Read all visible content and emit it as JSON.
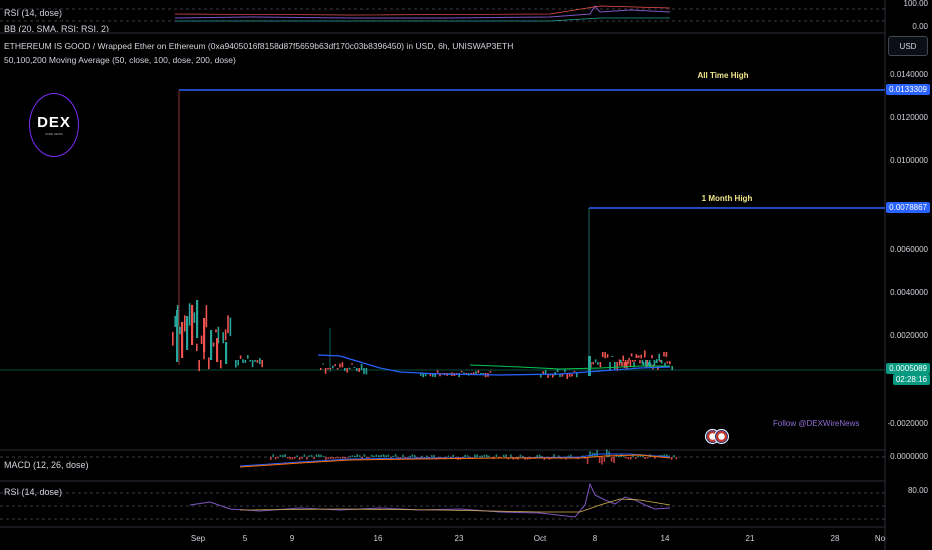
{
  "top_pane": {
    "rsi_label": "RSI (14, dose)",
    "bb_label": "BB (20, SMA, RSI: RSI, 2)",
    "axis_top": "100.00",
    "axis_bottom": "0.00"
  },
  "header": {
    "title": "ETHEREUM IS GOOD / Wrapped Ether on Ethereum (0xa9405016f8158d87f5659b63df170c03b8396450) in USD, 6h, UNISWAP3ETH",
    "ma_label": "50,100,200 Moving Average (50, close, 100, dose, 200, dose)",
    "currency": "USD"
  },
  "logo": {
    "text": "DEX",
    "sub": "WIRE NEWS"
  },
  "main_axis": {
    "ticks": [
      "0.0140000",
      "0.0120000",
      "0.0100000",
      "0.0080000",
      "0.0060000",
      "0.0040000",
      "0.0020000",
      "-0.0020000"
    ],
    "ath_tag": "0.0133309",
    "month_high_tag": "0.0078867",
    "last_price_tag": "0.0005089",
    "countdown_tag": "02:28:16"
  },
  "annotations": {
    "ath": "All Time High",
    "month_high": "1 Month High",
    "follow": "Follow @DEXWireNews"
  },
  "macd_pane": {
    "label": "MACD (12, 26, dose)",
    "axis": "0.0000000"
  },
  "rsi_pane": {
    "label": "RSI (14, dose)",
    "axis": "80.00"
  },
  "time_axis": {
    "labels": [
      "Sep",
      "5",
      "9",
      "16",
      "23",
      "Oct",
      "8",
      "14",
      "21",
      "28",
      "No"
    ]
  },
  "colors": {
    "ath_line": "#2962ff",
    "up_candle": "#26a69a",
    "down_candle": "#ef5350",
    "green_bar": "#00c853",
    "red_bar": "#ff1744",
    "ma50": "#2962ff",
    "ma100": "#00c853",
    "macd": "#2962ff",
    "signal": "#ff6d00",
    "rsi": "#7e57c2",
    "last_price": "#089981"
  }
}
